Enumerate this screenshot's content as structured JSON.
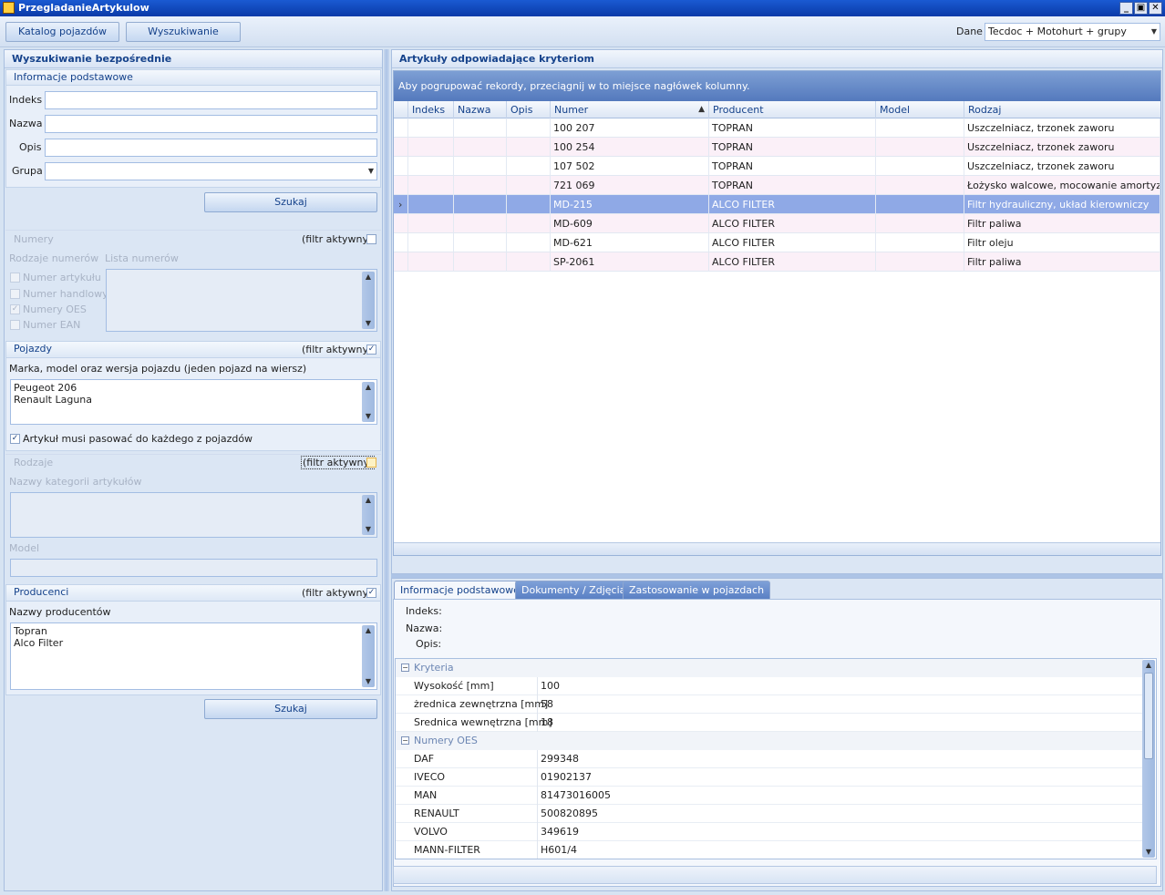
{
  "window": {
    "title": "PrzegladanieArtykulow",
    "minimize": "_",
    "restore": "▣",
    "close": "✕"
  },
  "toolbar": {
    "catalog_button": "Katalog pojazdów",
    "search_button": "Wyszukiwanie",
    "data_label": "Dane",
    "data_value": "Tecdoc + Motohurt + grupy"
  },
  "left": {
    "header": "Wyszukiwanie bezpośrednie",
    "basic": {
      "title": "Informacje podstawowe",
      "indeks_label": "Indeks",
      "nazwa_label": "Nazwa",
      "opis_label": "Opis",
      "grupa_label": "Grupa",
      "indeks_value": "",
      "nazwa_value": "",
      "opis_value": "",
      "grupa_value": ""
    },
    "search_button": "Szukaj",
    "numbers": {
      "title": "Numery",
      "filter_label": "(filtr aktywny)",
      "types_label": "Rodzaje numerów",
      "list_label": "Lista numerów",
      "options": [
        {
          "label": "Numer artykułu",
          "checked": false
        },
        {
          "label": "Numer handlowy",
          "checked": false
        },
        {
          "label": "Numery OES",
          "checked": true
        },
        {
          "label": "Numer EAN",
          "checked": false
        }
      ]
    },
    "vehicles": {
      "title": "Pojazdy",
      "filter_label": "(filtr aktywny)",
      "desc": "Marka, model oraz wersja pojazdu (jeden pojazd na wiersz)",
      "lines": [
        "Peugeot 206",
        "Renault Laguna"
      ],
      "match_all_label": "Artykuł musi pasować do każdego z pojazdów"
    },
    "kinds": {
      "title": "Rodzaje",
      "filter_label": "(filtr aktywny)",
      "names_label": "Nazwy kategorii artykułów",
      "model_label": "Model"
    },
    "producers": {
      "title": "Producenci",
      "filter_label": "(filtr aktywny)",
      "names_label": "Nazwy producentów",
      "lines": [
        "Topran",
        "Alco Filter"
      ]
    },
    "search_button2": "Szukaj"
  },
  "results": {
    "header": "Artykuły odpowiadające kryteriom",
    "group_hint": "Aby pogrupować rekordy, przeciągnij w to miejsce nagłówek kolumny.",
    "columns": [
      "Indeks",
      "Nazwa",
      "Opis",
      "Numer",
      "Producent",
      "Model",
      "Rodzaj"
    ],
    "sort_indicator": "▲",
    "rows": [
      {
        "indeks": "",
        "nazwa": "",
        "opis": "",
        "numer": "100 207",
        "producent": "TOPRAN",
        "model": "",
        "rodzaj": "Uszczelniacz, trzonek zaworu"
      },
      {
        "indeks": "",
        "nazwa": "",
        "opis": "",
        "numer": "100 254",
        "producent": "TOPRAN",
        "model": "",
        "rodzaj": "Uszczelniacz, trzonek zaworu"
      },
      {
        "indeks": "",
        "nazwa": "",
        "opis": "",
        "numer": "107 502",
        "producent": "TOPRAN",
        "model": "",
        "rodzaj": "Uszczelniacz, trzonek zaworu"
      },
      {
        "indeks": "",
        "nazwa": "",
        "opis": "",
        "numer": "721 069",
        "producent": "TOPRAN",
        "model": "",
        "rodzaj": "Łożysko walcowe, mocowanie amortyzatora"
      },
      {
        "indeks": "",
        "nazwa": "",
        "opis": "",
        "numer": "MD-215",
        "producent": "ALCO FILTER",
        "model": "",
        "rodzaj": "Filtr hydrauliczny, układ kierowniczy"
      },
      {
        "indeks": "",
        "nazwa": "",
        "opis": "",
        "numer": "MD-609",
        "producent": "ALCO FILTER",
        "model": "",
        "rodzaj": "Filtr paliwa"
      },
      {
        "indeks": "",
        "nazwa": "",
        "opis": "",
        "numer": "MD-621",
        "producent": "ALCO FILTER",
        "model": "",
        "rodzaj": "Filtr oleju"
      },
      {
        "indeks": "",
        "nazwa": "",
        "opis": "",
        "numer": "SP-2061",
        "producent": "ALCO FILTER",
        "model": "",
        "rodzaj": "Filtr paliwa"
      }
    ],
    "selected_row": 4,
    "row_indicator": "›"
  },
  "details": {
    "tabs": [
      "Informacje podstawowe",
      "Dokumenty / Zdjęcia",
      "Zastosowanie w pojazdach"
    ],
    "active_tab": 0,
    "indeks_label": "Indeks:",
    "nazwa_label": "Nazwa:",
    "opis_label": "Opis:",
    "indeks_value": "",
    "nazwa_value": "",
    "opis_value": "",
    "categories": [
      {
        "name": "Kryteria",
        "toggle": "⊟",
        "items": [
          {
            "key": "Wysokość [mm]",
            "value": "100"
          },
          {
            "key": "żrednica zewnętrzna [mm]",
            "value": "58"
          },
          {
            "key": "Srednica wewnętrzna [mm]",
            "value": "18"
          }
        ]
      },
      {
        "name": "Numery OES",
        "toggle": "⊟",
        "items": [
          {
            "key": "DAF",
            "value": "299348"
          },
          {
            "key": "IVECO",
            "value": "01902137"
          },
          {
            "key": "MAN",
            "value": "81473016005"
          },
          {
            "key": "RENAULT",
            "value": "500820895"
          },
          {
            "key": "VOLVO",
            "value": "349619"
          },
          {
            "key": "MANN-FILTER",
            "value": "H601/4"
          }
        ]
      }
    ]
  },
  "colors": {
    "accent": "#15428b",
    "selection": "#8fa9e6",
    "alt_row": "#fbf0f8",
    "hint_bar": "#5479bd"
  }
}
